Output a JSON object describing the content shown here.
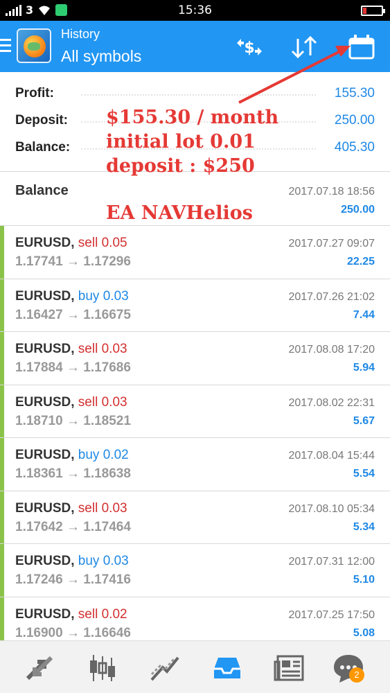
{
  "status_bar": {
    "network": "3",
    "time": "15:36"
  },
  "app_bar": {
    "title": "History",
    "subtitle": "All symbols",
    "icons": [
      "menu-icon",
      "app-logo",
      "currency-icon",
      "sort-icon",
      "calendar-icon"
    ]
  },
  "summary": {
    "profit_label": "Profit:",
    "profit_value": "155.30",
    "deposit_label": "Deposit:",
    "deposit_value": "250.00",
    "balance_label": "Balance:",
    "balance_value": "405.30"
  },
  "annotation": {
    "line1": "$155.30 / month",
    "line2": "initial lot 0.01",
    "line3": "deposit : $250",
    "ea_name": "EA NAVHelios",
    "color": "#e53935"
  },
  "balance_entry": {
    "label": "Balance",
    "date": "2017.07.18 18:56",
    "amount": "250.00"
  },
  "deals": [
    {
      "symbol": "EURUSD,",
      "type": "sell",
      "volume": "0.05",
      "open": "1.17741",
      "close": "1.17296",
      "date": "2017.07.27 09:07",
      "profit": "22.25"
    },
    {
      "symbol": "EURUSD,",
      "type": "buy",
      "volume": "0.03",
      "open": "1.16427",
      "close": "1.16675",
      "date": "2017.07.26 21:02",
      "profit": "7.44"
    },
    {
      "symbol": "EURUSD,",
      "type": "sell",
      "volume": "0.03",
      "open": "1.17884",
      "close": "1.17686",
      "date": "2017.08.08 17:20",
      "profit": "5.94"
    },
    {
      "symbol": "EURUSD,",
      "type": "sell",
      "volume": "0.03",
      "open": "1.18710",
      "close": "1.18521",
      "date": "2017.08.02 22:31",
      "profit": "5.67"
    },
    {
      "symbol": "EURUSD,",
      "type": "buy",
      "volume": "0.02",
      "open": "1.18361",
      "close": "1.18638",
      "date": "2017.08.04 15:44",
      "profit": "5.54"
    },
    {
      "symbol": "EURUSD,",
      "type": "sell",
      "volume": "0.03",
      "open": "1.17642",
      "close": "1.17464",
      "date": "2017.08.10 05:34",
      "profit": "5.34"
    },
    {
      "symbol": "EURUSD,",
      "type": "buy",
      "volume": "0.03",
      "open": "1.17246",
      "close": "1.17416",
      "date": "2017.07.31 12:00",
      "profit": "5.10"
    },
    {
      "symbol": "EURUSD,",
      "type": "sell",
      "volume": "0.02",
      "open": "1.16900",
      "close": "1.16646",
      "date": "2017.07.25 17:50",
      "profit": "5.08"
    }
  ],
  "arrow_symbol": "→",
  "bottom_nav": {
    "items": [
      "quotes-icon",
      "chart-icon",
      "trade-icon",
      "history-icon",
      "news-icon",
      "messages-icon"
    ],
    "active": "history-icon",
    "messages_badge": "2"
  },
  "colors": {
    "accent": "#2196f3",
    "profit": "#1e88e5",
    "sell": "#d32f2f",
    "buy": "#1e88e5",
    "row_marker": "#8bc34a"
  }
}
